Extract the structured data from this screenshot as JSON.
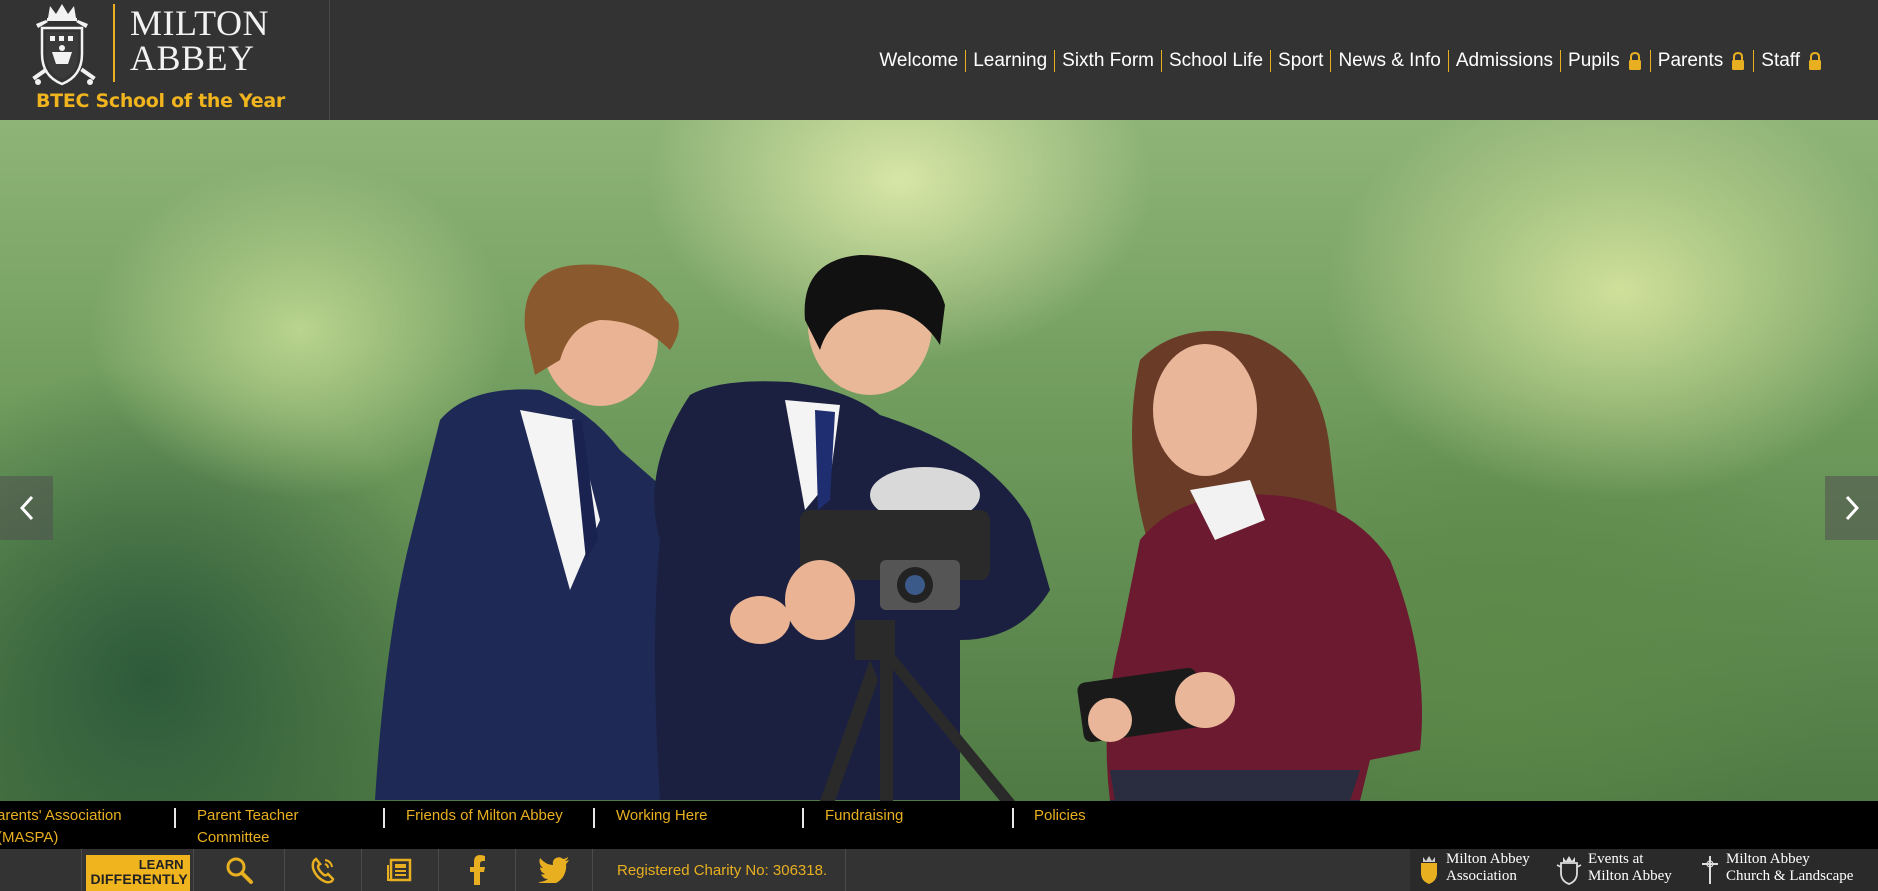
{
  "brand": {
    "name_line1": "MILTON",
    "name_line2": "ABBEY",
    "tagline": "BTEC School of the Year"
  },
  "nav": {
    "items": [
      {
        "label": "Welcome",
        "locked": false
      },
      {
        "label": "Learning",
        "locked": false
      },
      {
        "label": "Sixth Form",
        "locked": false
      },
      {
        "label": "School Life",
        "locked": false
      },
      {
        "label": "Sport",
        "locked": false
      },
      {
        "label": "News & Info",
        "locked": false
      },
      {
        "label": "Admissions",
        "locked": false
      },
      {
        "label": "Pupils",
        "locked": true
      },
      {
        "label": "Parents",
        "locked": true
      },
      {
        "label": "Staff",
        "locked": true
      }
    ],
    "lock_icon": "lock-icon"
  },
  "hero": {
    "prev_icon": "chevron-left-icon",
    "next_icon": "chevron-right-icon"
  },
  "links": {
    "items": [
      "arents' Association (MASPA)",
      "Parent Teacher Committee",
      "Friends of Milton Abbey",
      "Working Here",
      "Fundraising",
      "Policies"
    ]
  },
  "footer": {
    "learn_line1": "LEARN",
    "learn_line2": "DIFFERENTLY",
    "charity": "Registered Charity No: 306318.",
    "icons": [
      "search-icon",
      "phone-icon",
      "newsletter-icon",
      "facebook-icon",
      "twitter-icon"
    ],
    "associations": [
      {
        "line1": "Milton Abbey",
        "line2": "Association"
      },
      {
        "line1": "Events at",
        "line2": "Milton Abbey"
      },
      {
        "line1": "Milton Abbey",
        "line2": "Church & Landscape"
      }
    ]
  },
  "colors": {
    "header_bg": "#333333",
    "accent_gold": "#e8b020",
    "links_bg": "#000000"
  }
}
